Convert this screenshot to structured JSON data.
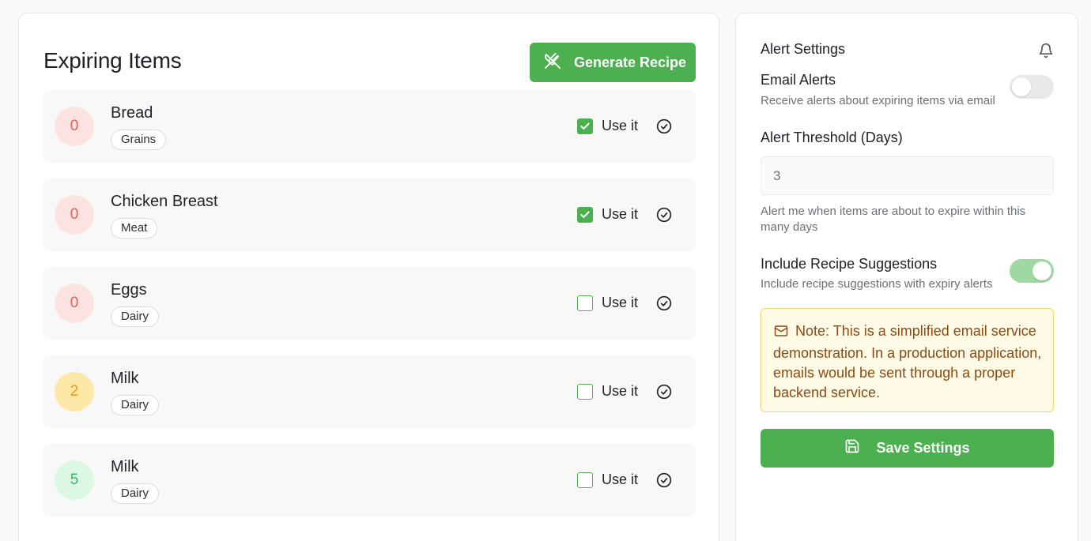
{
  "expiring": {
    "title": "Expiring Items",
    "generate_label": "Generate Recipe",
    "use_label": "Use it",
    "items": [
      {
        "days": "0",
        "name": "Bread",
        "category": "Grains",
        "checked": true,
        "level": "red"
      },
      {
        "days": "0",
        "name": "Chicken Breast",
        "category": "Meat",
        "checked": true,
        "level": "red"
      },
      {
        "days": "0",
        "name": "Eggs",
        "category": "Dairy",
        "checked": false,
        "level": "red"
      },
      {
        "days": "2",
        "name": "Milk",
        "category": "Dairy",
        "checked": false,
        "level": "yellow"
      },
      {
        "days": "5",
        "name": "Milk",
        "category": "Dairy",
        "checked": false,
        "level": "green"
      }
    ]
  },
  "alerts": {
    "title": "Alert Settings",
    "email": {
      "title": "Email Alerts",
      "desc": "Receive alerts about expiring items via email",
      "enabled": false
    },
    "threshold": {
      "title": "Alert Threshold (Days)",
      "placeholder": "3",
      "desc": "Alert me when items are about to expire within this many days"
    },
    "recipes": {
      "title": "Include Recipe Suggestions",
      "desc": "Include recipe suggestions with expiry alerts",
      "enabled": true
    },
    "note": "Note: This is a simplified email service demonstration. In a production application, emails would be sent through a proper backend service.",
    "save_label": "Save Settings"
  },
  "colors": {
    "accent": "#4caf50",
    "badge_red_bg": "#fde2e2",
    "badge_yellow_bg": "#fde8a8",
    "badge_green_bg": "#dcf7e4",
    "note_bg": "#fffbe6"
  },
  "icons": [
    "utensils-icon",
    "checkbox-check-icon",
    "check-circle-icon",
    "bell-icon",
    "mail-icon",
    "save-icon"
  ]
}
